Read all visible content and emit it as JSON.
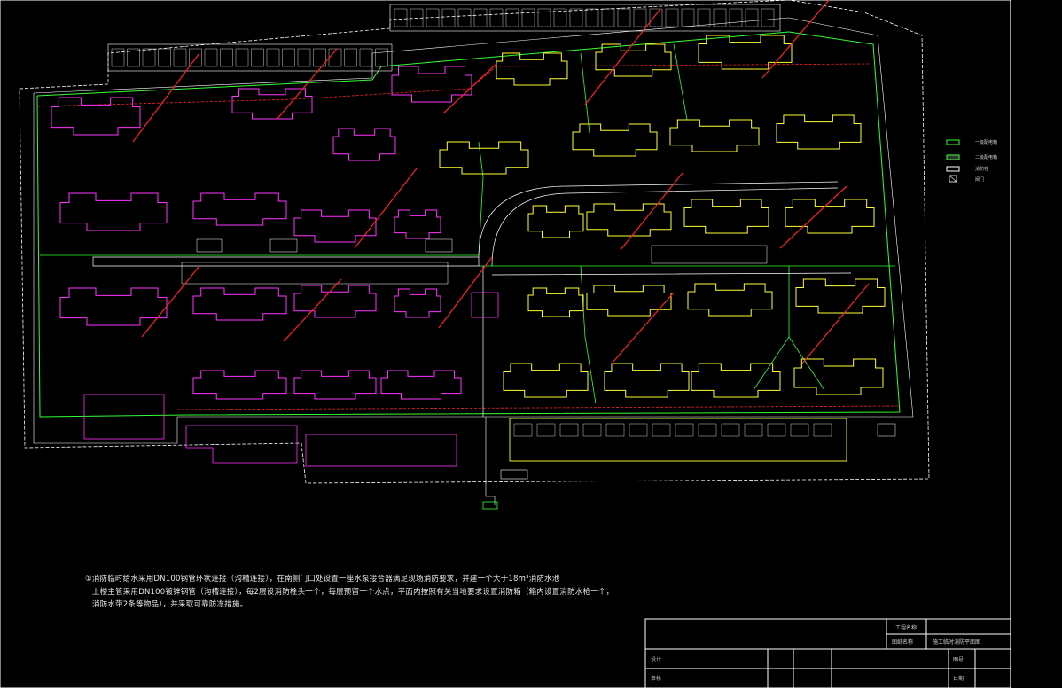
{
  "drawing": {
    "notes": [
      "①消防临时给水采用DN100钢管环状连接（沟槽连接），在南侧门口处设置一座水泵接合器满足现场消防要求，并建一个大于18m³消防水池",
      "上楼主管采用DN100镀锌钢管（沟槽连接），每2层设消防栓头一个，每层预留一个水点，平面内按照有关当地要求设置消防箱（箱内设置消防水枪一个，",
      "消防水带2条等物品），并采取可靠防冻措施。"
    ],
    "legend": [
      {
        "label": "一级配电箱",
        "color": "#33ff33"
      },
      {
        "label": "二级配电箱",
        "color": "#33ff33"
      },
      {
        "label": "消防栓",
        "color": "#ffffff"
      },
      {
        "label": "阀门",
        "color": "#ffffff"
      }
    ],
    "title_block": {
      "row1": "工程名称",
      "row2": "图纸名称",
      "drawing_name": "施工临时消防平面图",
      "label_a": "设计",
      "label_b": "审核",
      "label_c": "图号",
      "label_d": "日期"
    },
    "colors": {
      "building_magenta": "#ff33ff",
      "building_yellow": "#ffff33",
      "pipe_green": "#33ff33",
      "fire_red": "#ff2222",
      "boundary_white": "#ffffff"
    }
  }
}
